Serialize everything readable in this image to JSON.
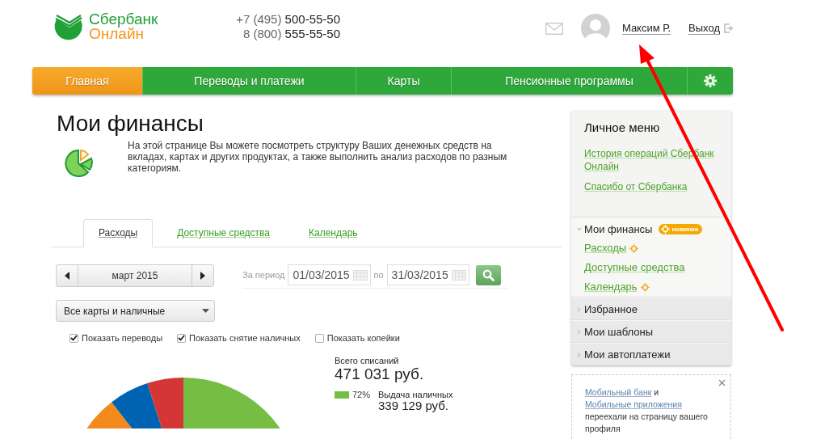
{
  "header": {
    "logo": {
      "line1": "Сбербанк",
      "line2": "Онлайн"
    },
    "phones": [
      {
        "prefix": "+7 (495)",
        "number": "500-55-50"
      },
      {
        "prefix": "8 (800)",
        "number": "555-55-50"
      }
    ],
    "user": {
      "name": "Максим Р."
    },
    "logout": {
      "label": "Выход"
    }
  },
  "nav": {
    "items": [
      {
        "label": "Главная",
        "selected": true
      },
      {
        "label": "Переводы и платежи",
        "selected": false
      },
      {
        "label": "Карты",
        "selected": false
      },
      {
        "label": "Пенсионные программы",
        "selected": false
      }
    ]
  },
  "page": {
    "title": "Мои финансы",
    "description": "На этой странице Вы можете посмотреть структуру Ваших денежных средств на вкладах, картах и других продуктах, а также выполнить анализ расходов по разным категориям."
  },
  "tabs": [
    {
      "label": "Расходы",
      "selected": true
    },
    {
      "label": "Доступные средства",
      "selected": false
    },
    {
      "label": "Календарь",
      "selected": false
    }
  ],
  "filters": {
    "month": "март 2015",
    "period_label": "За период",
    "from": "01/03/2015",
    "to_label": "по",
    "to": "31/03/2015",
    "account": "Все карты и наличные",
    "checkboxes": [
      {
        "label": "Показать переводы",
        "checked": true
      },
      {
        "label": "Показать снятие наличных",
        "checked": true
      },
      {
        "label": "Показать копейки",
        "checked": false
      }
    ]
  },
  "summary": {
    "total_label": "Всего списаний",
    "total_value": "471 031 руб.",
    "items": [
      {
        "percent": "72%",
        "label": "Выдача наличных",
        "value": "339 129 руб.",
        "color": "#76bd43"
      }
    ]
  },
  "sidebar": {
    "title": "Личное меню",
    "links": [
      "История операций Сбербанк Онлайн",
      "Спасибо от Сбербанка"
    ],
    "sections": [
      {
        "label": "Мои финансы",
        "expanded": true,
        "badge": "новинка",
        "items": [
          {
            "label": "Расходы",
            "new": true
          },
          {
            "label": "Доступные средства",
            "new": false
          },
          {
            "label": "Календарь",
            "new": true
          }
        ]
      },
      {
        "label": "Избранное",
        "expanded": false
      },
      {
        "label": "Мои шаблоны",
        "expanded": false
      },
      {
        "label": "Мои автоплатежи",
        "expanded": false
      }
    ]
  },
  "notice": {
    "segments": [
      {
        "text": "Мобильный банк",
        "link": true
      },
      {
        "text": " и ",
        "link": false
      },
      {
        "text": "Мобильные приложения",
        "link": true
      },
      {
        "text": " переехали на страницу вашего профиля",
        "link": false
      }
    ]
  }
}
